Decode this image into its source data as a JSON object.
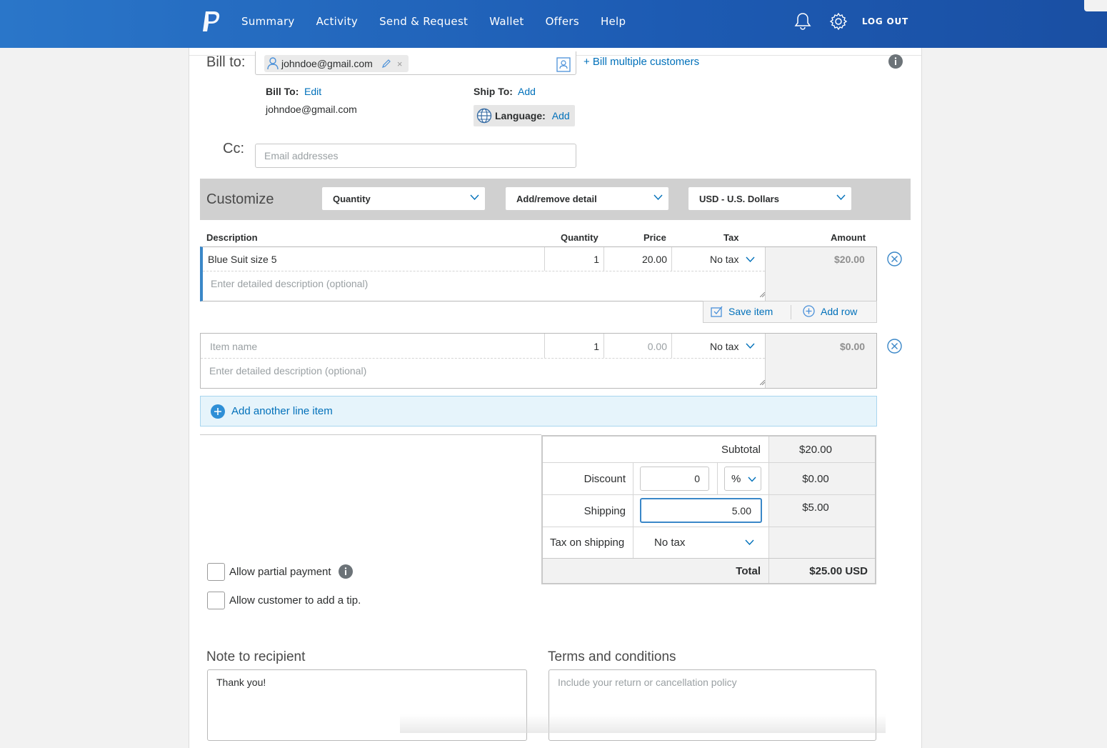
{
  "nav": {
    "links": [
      "Summary",
      "Activity",
      "Send & Request",
      "Wallet",
      "Offers",
      "Help"
    ],
    "logout": "LOG OUT"
  },
  "bill": {
    "label": "Bill to:",
    "chip_email": "johndoe@gmail.com",
    "multiple": "+ Bill multiple customers",
    "bill_to_label": "Bill To:",
    "bill_to_edit": "Edit",
    "bill_to_email": "johndoe@gmail.com",
    "ship_to_label": "Ship To:",
    "ship_to_add": "Add",
    "language_label": "Language:",
    "language_add": "Add"
  },
  "cc": {
    "label": "Cc:",
    "placeholder": "Email addresses"
  },
  "customize": {
    "label": "Customize",
    "selects": [
      "Quantity",
      "Add/remove detail",
      "USD - U.S. Dollars"
    ]
  },
  "columns": {
    "description": "Description",
    "quantity": "Quantity",
    "price": "Price",
    "tax": "Tax",
    "amount": "Amount"
  },
  "items": [
    {
      "name": "Blue Suit size 5",
      "name_placeholder": "",
      "detail_placeholder": "Enter detailed description (optional)",
      "quantity": "1",
      "price": "20.00",
      "tax": "No tax",
      "amount": "$20.00"
    },
    {
      "name": "",
      "name_placeholder": "Item name",
      "detail_placeholder": "Enter detailed description (optional)",
      "quantity": "1",
      "price": "0.00",
      "tax": "No tax",
      "amount": "$0.00"
    }
  ],
  "item_actions": {
    "save": "Save item",
    "add_row": "Add row"
  },
  "add_line": "Add another line item",
  "totals": {
    "subtotal_label": "Subtotal",
    "subtotal": "$20.00",
    "discount_label": "Discount",
    "discount_value": "0",
    "discount_unit": "%",
    "discount_amount": "$0.00",
    "shipping_label": "Shipping",
    "shipping_value": "5.00",
    "shipping_amount": "$5.00",
    "tax_shipping_label": "Tax on shipping",
    "tax_shipping_value": "No tax",
    "total_label": "Total",
    "total": "$25.00 USD"
  },
  "options": {
    "partial": "Allow partial payment",
    "tip": "Allow customer to add a tip."
  },
  "note": {
    "label": "Note to recipient",
    "value": "Thank you!"
  },
  "terms": {
    "label": "Terms and conditions",
    "placeholder": "Include your return or cancellation policy"
  },
  "colors": {
    "nav": "#1d5bb3",
    "link": "#0070ba",
    "accent_bar": "#3a87c8"
  }
}
